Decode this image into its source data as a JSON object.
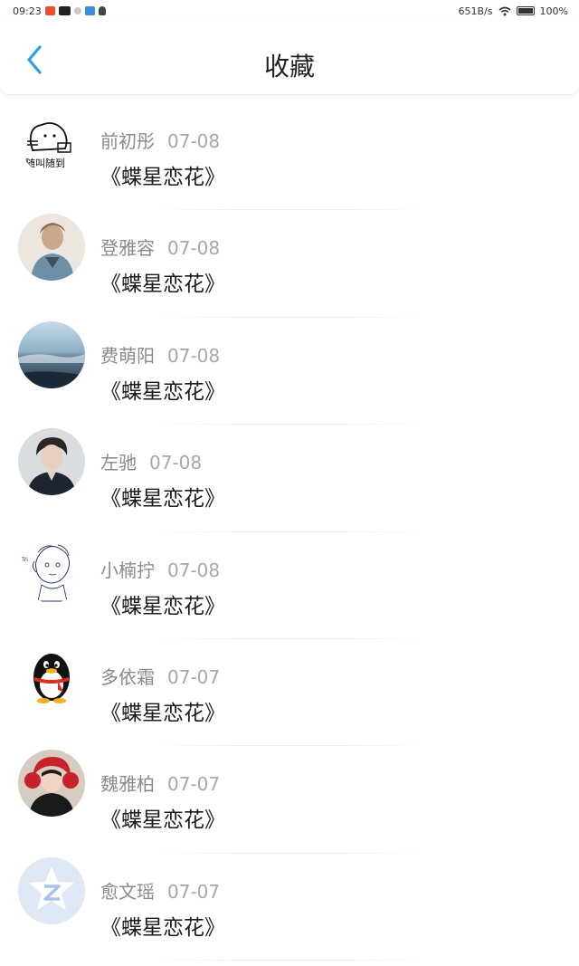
{
  "status_bar": {
    "time": "09:23",
    "net_speed": "651B/s",
    "battery": "100%"
  },
  "header": {
    "title": "收藏",
    "back_icon": "chevron-left-icon",
    "accent": "#2b9fe6"
  },
  "favorites": [
    {
      "name": "前初彤",
      "date": "07-08",
      "title": "《蝶星恋花》",
      "avatar": "doodle-avatar"
    },
    {
      "name": "登雅容",
      "date": "07-08",
      "title": "《蝶星恋花》",
      "avatar": "photo-avatar"
    },
    {
      "name": "费萌阳",
      "date": "07-08",
      "title": "《蝶星恋花》",
      "avatar": "landscape-avatar"
    },
    {
      "name": "左驰",
      "date": "07-08",
      "title": "《蝶星恋花》",
      "avatar": "portrait-avatar"
    },
    {
      "name": "小楠拧",
      "date": "07-08",
      "title": "《蝶星恋花》",
      "avatar": "sketch-avatar"
    },
    {
      "name": "多依霜",
      "date": "07-07",
      "title": "《蝶星恋花》",
      "avatar": "penguin-avatar"
    },
    {
      "name": "魏雅柏",
      "date": "07-07",
      "title": "《蝶星恋花》",
      "avatar": "red-hat-avatar"
    },
    {
      "name": "愈文瑶",
      "date": "07-07",
      "title": "《蝶星恋花》",
      "avatar": "default-z-avatar"
    }
  ]
}
